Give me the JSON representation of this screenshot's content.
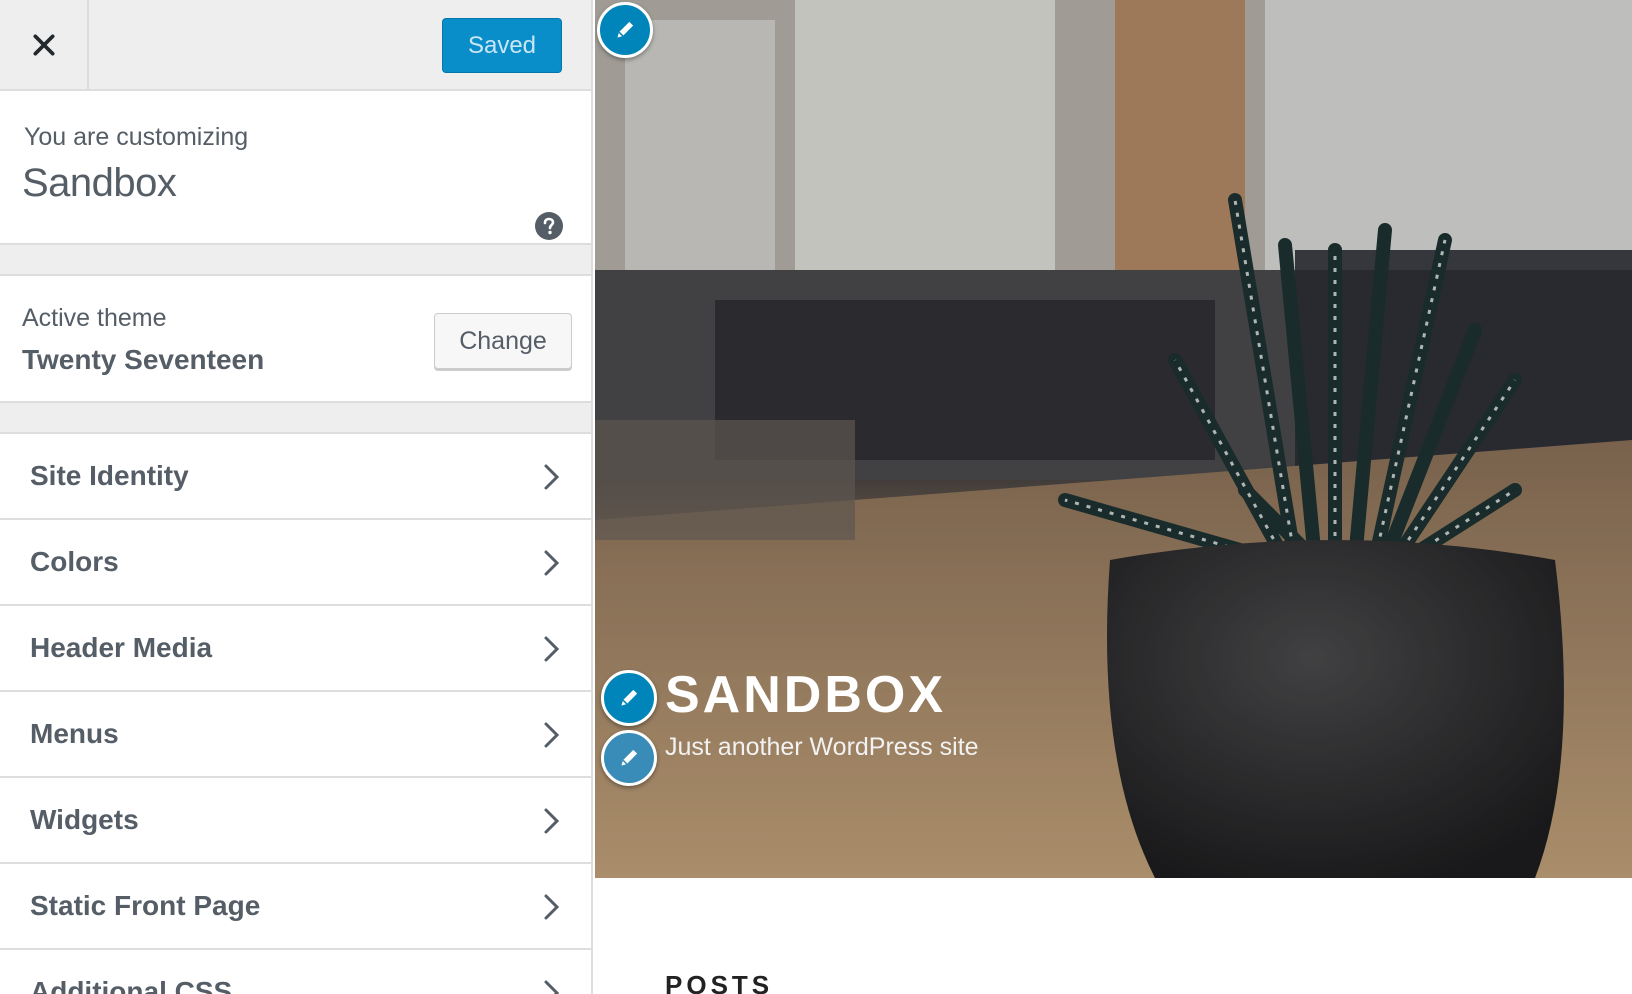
{
  "topbar": {
    "close_icon": "close-icon",
    "saved_label": "Saved"
  },
  "info": {
    "customizing_label": "You are customizing",
    "site_name": "Sandbox",
    "help_icon": "help-icon"
  },
  "theme": {
    "label": "Active theme",
    "name": "Twenty Seventeen",
    "change_label": "Change"
  },
  "sections": [
    {
      "label": "Site Identity"
    },
    {
      "label": "Colors"
    },
    {
      "label": "Header Media"
    },
    {
      "label": "Menus"
    },
    {
      "label": "Widgets"
    },
    {
      "label": "Static Front Page"
    },
    {
      "label": "Additional CSS"
    }
  ],
  "preview": {
    "site_title": "SANDBOX",
    "tagline": "Just another WordPress site",
    "posts_heading": "POSTS",
    "edit_icon": "pencil-icon"
  },
  "colors": {
    "accent": "#0085ba",
    "saved_bg": "#0a8ec9",
    "sidebar_bg": "#eeeeee",
    "text": "#555d66"
  }
}
